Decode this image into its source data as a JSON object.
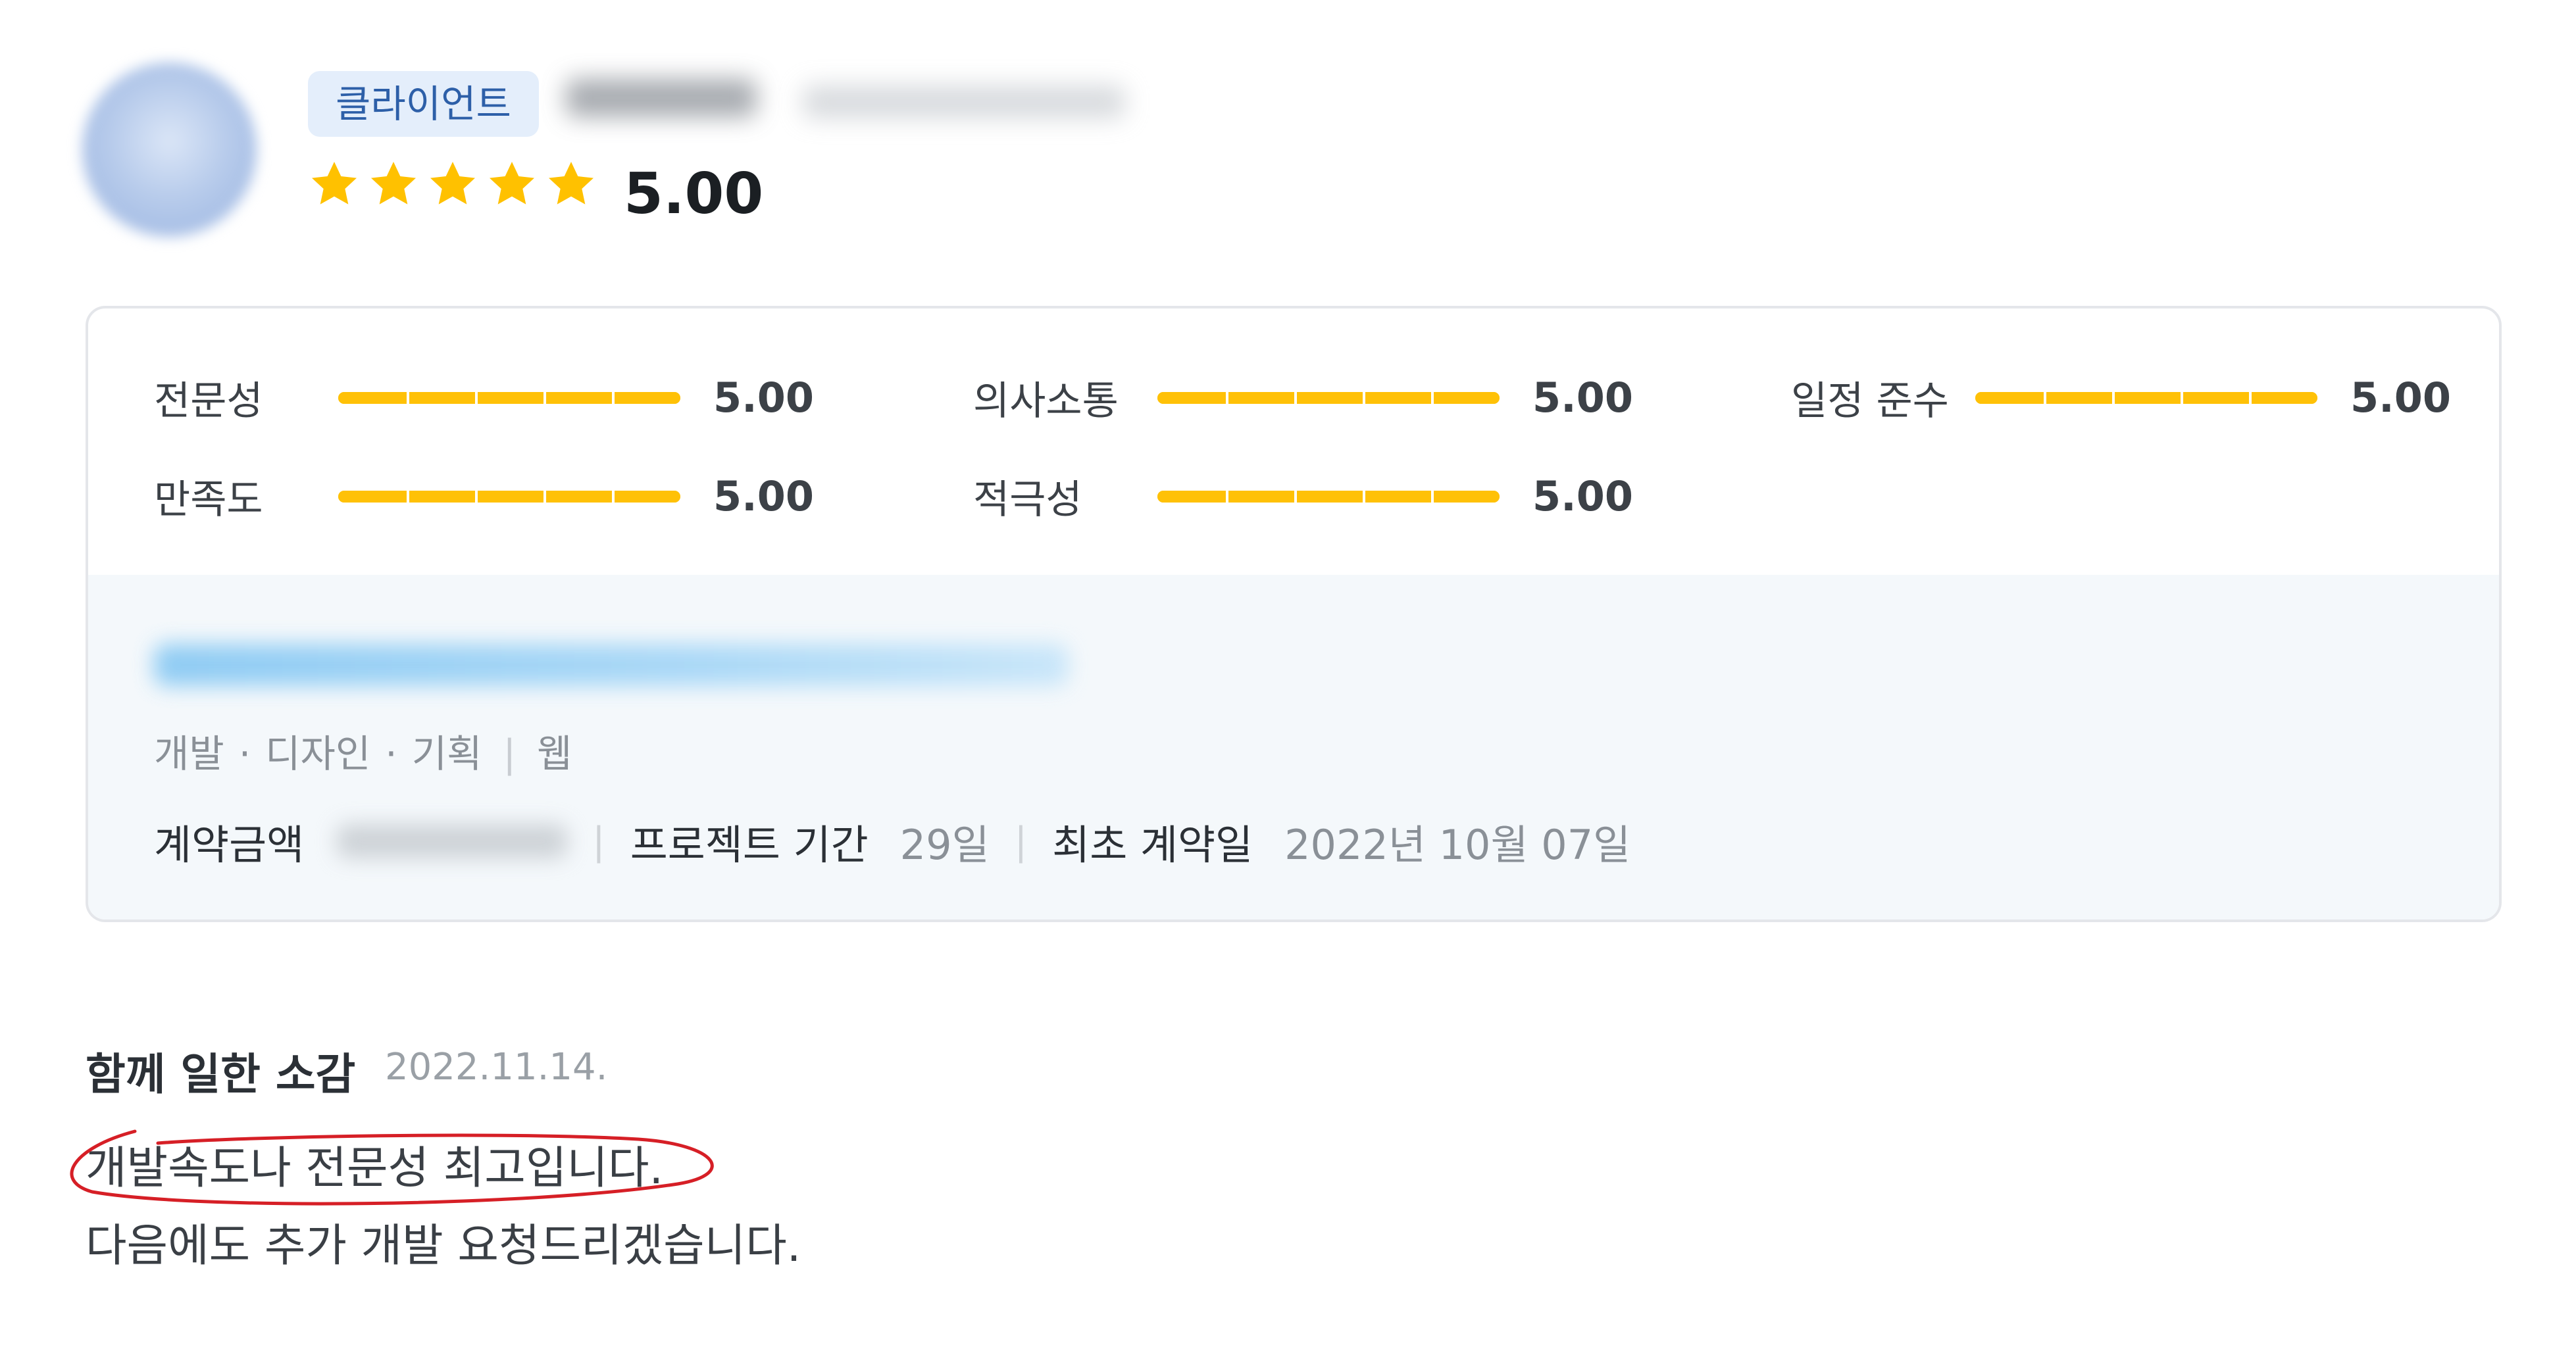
{
  "header": {
    "role_badge": "클라이언트",
    "rating": 5,
    "rating_text": "5.00",
    "star_count": 5
  },
  "scores": [
    {
      "label": "전문성",
      "value": "5.00",
      "fraction": 1.0
    },
    {
      "label": "의사소통",
      "value": "5.00",
      "fraction": 1.0
    },
    {
      "label": "일정 준수",
      "value": "5.00",
      "fraction": 1.0
    },
    {
      "label": "만족도",
      "value": "5.00",
      "fraction": 1.0
    },
    {
      "label": "적극성",
      "value": "5.00",
      "fraction": 1.0
    }
  ],
  "project": {
    "categories": [
      "개발",
      "디자인",
      "기획"
    ],
    "category_dot": "·",
    "platform": "웹",
    "separator": "|",
    "amount_label": "계약금액",
    "period_label": "프로젝트 기간",
    "period_value": "29일",
    "first_contract_label": "최초 계약일",
    "first_contract_value": "2022년 10월 07일"
  },
  "review": {
    "title": "함께 일한 소감",
    "date": "2022.11.14.",
    "line1": "개발속도나 전문성 최고입니다.",
    "line2": "다음에도 추가 개발 요청드리겠습니다."
  },
  "colors": {
    "star": "#ffc100",
    "bar": "#ffc107",
    "badge_bg": "#e4eefb",
    "badge_text": "#2d5fa8",
    "project_bg": "#f4f8fb",
    "annotation": "#d61f26"
  }
}
